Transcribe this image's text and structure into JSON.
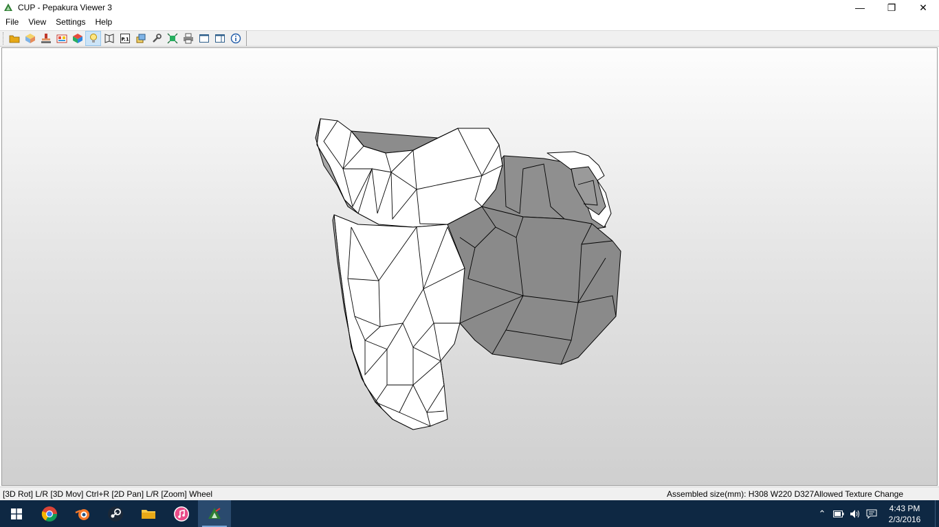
{
  "window": {
    "title": "CUP - Pepakura Viewer 3",
    "minimize_glyph": "—",
    "maximize_glyph": "❐",
    "close_glyph": "✕"
  },
  "menu": {
    "items": [
      "File",
      "View",
      "Settings",
      "Help"
    ]
  },
  "toolbar": {
    "buttons": [
      {
        "icon": "open-folder-icon"
      },
      {
        "icon": "3d-box-icon"
      },
      {
        "icon": "stamp-icon"
      },
      {
        "icon": "texture-icon"
      },
      {
        "icon": "color-cube-icon"
      },
      {
        "icon": "lightbulb-icon",
        "active": true
      },
      {
        "icon": "wireframe-icon"
      },
      {
        "icon": "page-number-icon",
        "label": "P.1"
      },
      {
        "icon": "layers-icon"
      },
      {
        "icon": "wrench-icon"
      },
      {
        "icon": "assembly-icon"
      },
      {
        "icon": "printer-icon"
      },
      {
        "icon": "single-view-icon"
      },
      {
        "icon": "split-view-icon"
      },
      {
        "icon": "info-icon"
      }
    ]
  },
  "status": {
    "left": "[3D Rot] L/R [3D Mov] Ctrl+R [2D Pan] L/R [Zoom] Wheel",
    "right": "Assembled size(mm): H308 W220 D327Allowed Texture Change"
  },
  "taskbar": {
    "apps": [
      "chrome-icon",
      "blender-icon",
      "steam-icon",
      "file-explorer-icon",
      "itunes-icon",
      "pepakura-icon"
    ],
    "time": "4:43 PM",
    "date": "2/3/2016",
    "tray_chevron": "⌃"
  },
  "colors": {
    "accent": "#0e2843",
    "viewport_top": "#fdfdfd",
    "viewport_bottom": "#cfcfcf",
    "model_light": "#ffffff",
    "model_dark": "#8c8c8c"
  }
}
